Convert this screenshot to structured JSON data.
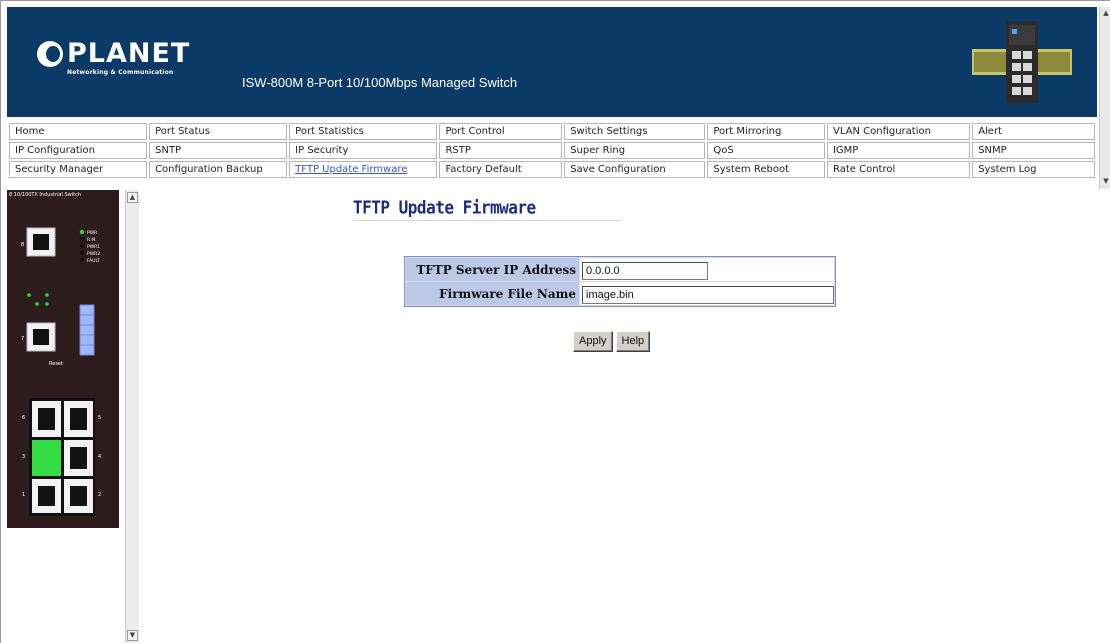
{
  "header": {
    "logo_text": "PLANET",
    "logo_subtitle": "Networking & Communication",
    "product_title": "ISW-800M 8-Port 10/100Mbps Managed Switch"
  },
  "nav": {
    "rows": [
      [
        "Home",
        "Port Status",
        "Port Statistics",
        "Port Control",
        "Switch Settings",
        "Port Mirroring",
        "VLAN Configuration",
        "Alert"
      ],
      [
        "IP Configuration",
        "SNTP",
        "IP Security",
        "RSTP",
        "Super Ring",
        "QoS",
        "IGMP",
        "SNMP"
      ],
      [
        "Security Manager",
        "Configuration Backup",
        "TFTP Update Firmware",
        "Factory Default",
        "Save Configuration",
        "System Reboot",
        "Rate Control",
        "System Log"
      ]
    ],
    "active": "TFTP Update Firmware"
  },
  "panel": {
    "caption": "8 10/100TX Industrial Switch",
    "led_labels": [
      "PWR",
      "R.M.",
      "PWR1",
      "PWR2",
      "FAULT"
    ],
    "reset_label": "Reset"
  },
  "main": {
    "title": "TFTP Update Firmware",
    "fields": {
      "server_ip_label": "TFTP Server IP Address",
      "server_ip_value": "0.0.0.0",
      "file_name_label": "Firmware File Name",
      "file_name_value": "image.bin"
    },
    "apply_label": "Apply",
    "help_label": "Help"
  },
  "colors": {
    "banner": "#0b3a66",
    "title": "#1a2a8a",
    "form_label_bg": "#bcc9e6",
    "active_link": "#3355cc"
  }
}
